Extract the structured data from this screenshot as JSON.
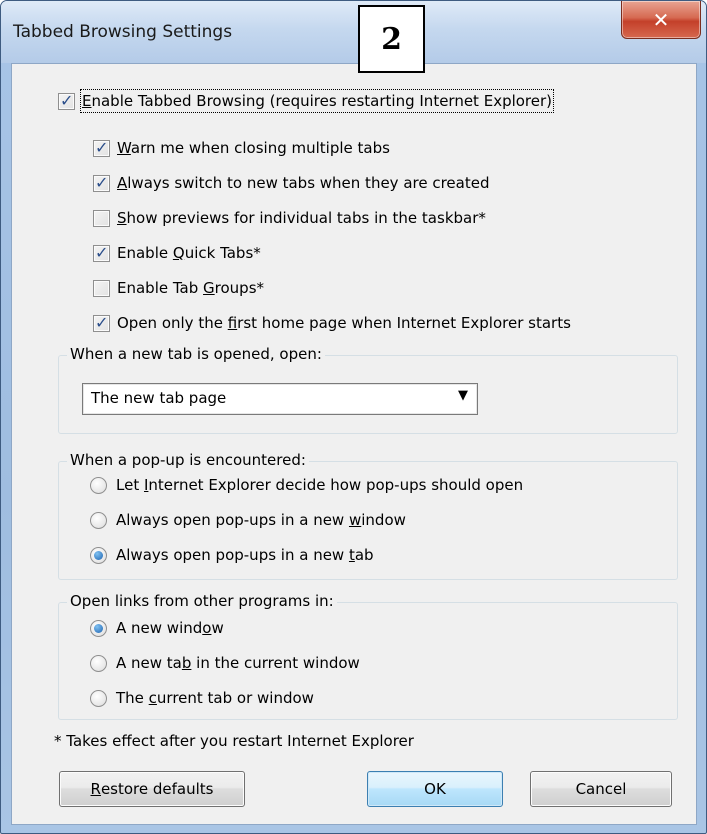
{
  "window": {
    "title": "Tabbed Browsing Settings",
    "step_badge": "2",
    "close_glyph": "✕"
  },
  "enable_tabbed": {
    "label_pre": "",
    "label_ul": "E",
    "label_post": "nable Tabbed Browsing (requires restarting Internet Explorer)",
    "checked": true
  },
  "options": [
    {
      "pre": "",
      "ul": "W",
      "post": "arn me when closing multiple tabs",
      "checked": true
    },
    {
      "pre": "",
      "ul": "A",
      "post": "lways switch to new tabs when they are created",
      "checked": true
    },
    {
      "pre": "",
      "ul": "S",
      "post": "how previews for individual tabs in the taskbar*",
      "checked": false
    },
    {
      "pre": "Enable ",
      "ul": "Q",
      "post": "uick Tabs*",
      "checked": true
    },
    {
      "pre": "Enable Tab ",
      "ul": "G",
      "post": "roups*",
      "checked": false
    },
    {
      "pre": "Open only the ",
      "ul": "f",
      "post": "irst home page when Internet Explorer starts",
      "checked": true
    }
  ],
  "new_tab_group": {
    "title": "When a new tab is opened, open:",
    "selected": "The new tab page",
    "arrow_icon": "▼"
  },
  "popup_group": {
    "title": "When a pop-up is encountered:",
    "options": [
      {
        "pre": "Let ",
        "ul": "I",
        "post": "nternet Explorer decide how pop-ups should open",
        "checked": false
      },
      {
        "pre": "Always open pop-ups in a new ",
        "ul": "w",
        "post": "indow",
        "checked": false
      },
      {
        "pre": "Always open pop-ups in a new ",
        "ul": "t",
        "post": "ab",
        "checked": true
      }
    ]
  },
  "links_group": {
    "title": "Open links from other programs in:",
    "options": [
      {
        "pre": "A new wind",
        "ul": "o",
        "post": "w",
        "checked": true
      },
      {
        "pre": "A new ta",
        "ul": "b",
        "post": " in the current window",
        "checked": false
      },
      {
        "pre": "The ",
        "ul": "c",
        "post": "urrent tab or window",
        "checked": false
      }
    ]
  },
  "footnote": "* Takes effect after you restart Internet Explorer",
  "buttons": {
    "restore_pre": "",
    "restore_ul": "R",
    "restore_post": "estore defaults",
    "ok": "OK",
    "cancel": "Cancel"
  }
}
